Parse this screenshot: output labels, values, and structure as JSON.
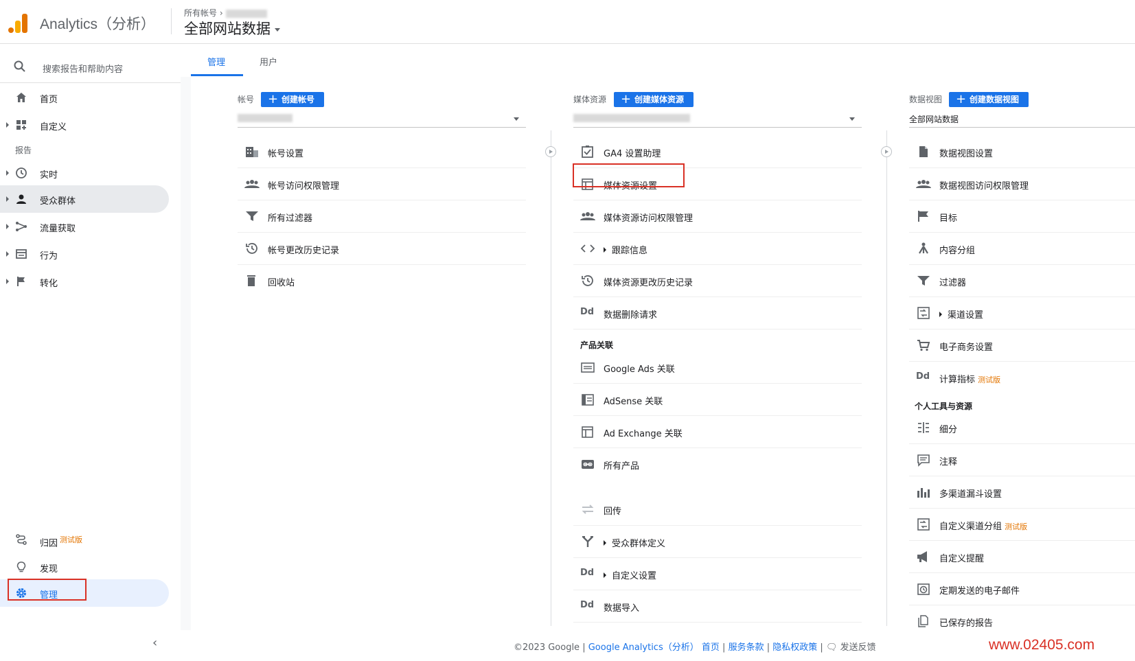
{
  "header": {
    "app_title": "Analytics（分析）",
    "breadcrumb": "所有帐号 ›",
    "property_title": "全部网站数据"
  },
  "sidebar": {
    "search_placeholder": "搜索报告和帮助内容",
    "home": "首页",
    "customization": "自定义",
    "reports_section": "报告",
    "realtime": "实时",
    "audience": "受众群体",
    "acquisition": "流量获取",
    "behavior": "行为",
    "conversions": "转化",
    "attribution": "归因",
    "attribution_beta": "测试版",
    "discover": "发现",
    "admin": "管理"
  },
  "tabs": {
    "admin": "管理",
    "user": "用户"
  },
  "account_col": {
    "label": "帐号",
    "create": "创建帐号",
    "items": [
      "帐号设置",
      "帐号访问权限管理",
      "所有过滤器",
      "帐号更改历史记录",
      "回收站"
    ]
  },
  "property_col": {
    "label": "媒体资源",
    "create": "创建媒体资源",
    "items": [
      "GA4 设置助理",
      "媒体资源设置",
      "媒体资源访问权限管理",
      "跟踪信息",
      "媒体资源更改历史记录",
      "数据删除请求"
    ],
    "product_links_title": "产品关联",
    "links": [
      "Google Ads 关联",
      "AdSense 关联",
      "Ad Exchange 关联",
      "所有产品"
    ],
    "more": [
      "回传",
      "受众群体定义",
      "自定义设置",
      "数据导入"
    ]
  },
  "view_col": {
    "label": "数据视图",
    "create": "创建数据视图",
    "selected": "全部网站数据",
    "items": [
      "数据视图设置",
      "数据视图访问权限管理",
      "目标",
      "内容分组",
      "过滤器",
      "渠道设置",
      "电子商务设置",
      "计算指标"
    ],
    "beta": "测试版",
    "personal_title": "个人工具与资源",
    "personal": [
      "细分",
      "注释",
      "多渠道漏斗设置",
      "自定义渠道分组",
      "自定义提醒",
      "定期发送的电子邮件",
      "已保存的报告"
    ]
  },
  "footer": {
    "copyright": "©2023 Google |",
    "ga": "Google Analytics（分析）",
    "home": "首页",
    "terms": "服务条款",
    "privacy": "隐私权政策",
    "feedback": "发送反馈",
    "sep": "|"
  },
  "watermark": "www.02405.com",
  "colors": {
    "accent": "#1a73e8",
    "highlight": "#d93025",
    "beta": "#e37400"
  }
}
